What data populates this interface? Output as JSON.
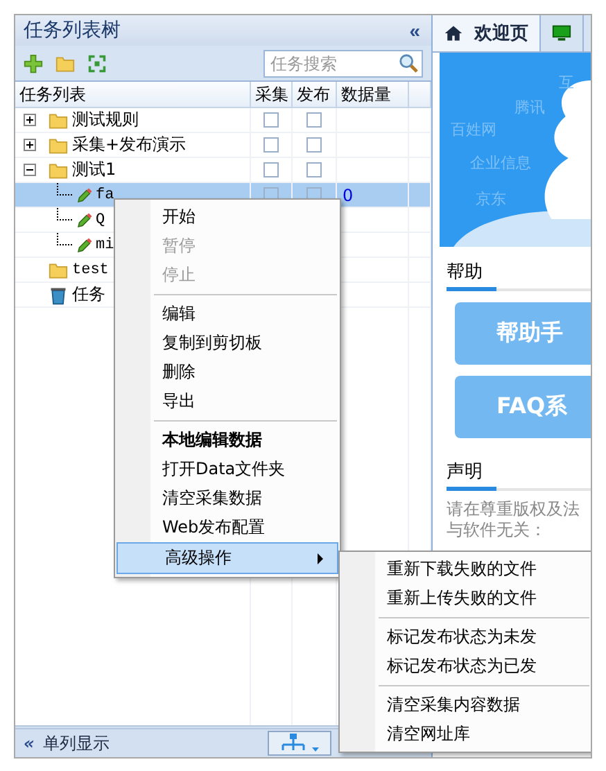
{
  "left_panel": {
    "title": "任务列表树",
    "collapse": "«",
    "search": {
      "placeholder": "任务搜索"
    },
    "columns": [
      "任务列表",
      "采集",
      "发布",
      "数据量"
    ],
    "tree": [
      {
        "label": "测试规则",
        "kind": "folder",
        "expanded": false,
        "selected": false,
        "collect": false,
        "publish": false
      },
      {
        "label": "采集+发布演示",
        "kind": "folder",
        "expanded": false,
        "selected": false,
        "collect": false,
        "publish": false
      },
      {
        "label": "测试1",
        "kind": "folder",
        "expanded": true,
        "selected": false,
        "collect": false,
        "publish": false,
        "children": [
          {
            "label": "fa",
            "kind": "task",
            "selected": true,
            "collect": false,
            "publish": false,
            "count": "0"
          },
          {
            "label": "Q",
            "kind": "task",
            "selected": false
          },
          {
            "label": "mi",
            "kind": "task",
            "selected": false
          }
        ]
      },
      {
        "label": "test",
        "kind": "folder",
        "selected": false
      },
      {
        "label": "任务",
        "kind": "recycle",
        "selected": false
      }
    ],
    "footer": {
      "collapse": "«",
      "label": "单列显示"
    }
  },
  "right_panel": {
    "tabs": [
      {
        "label": "欢迎页",
        "kind": "home",
        "selected": true
      },
      {
        "kind": "monitor",
        "selected": false
      }
    ],
    "banner_words": [
      "互",
      "腾讯",
      "百姓网",
      "企业信息",
      "京东"
    ],
    "help": {
      "title": "帮助",
      "buttons": [
        "帮助手",
        "FAQ系"
      ]
    },
    "notice": {
      "title": "声明",
      "lines": [
        "请在尊重版权及法",
        "与软件无关："
      ]
    }
  },
  "context_menu": [
    {
      "kind": "item",
      "label": "开始",
      "disabled": false
    },
    {
      "kind": "item",
      "label": "暂停",
      "disabled": true
    },
    {
      "kind": "item",
      "label": "停止",
      "disabled": true
    },
    {
      "kind": "separator"
    },
    {
      "kind": "item",
      "label": "编辑",
      "disabled": false
    },
    {
      "kind": "item",
      "label": "复制到剪切板",
      "disabled": false
    },
    {
      "kind": "item",
      "label": "删除",
      "disabled": false
    },
    {
      "kind": "item",
      "label": "导出",
      "disabled": false
    },
    {
      "kind": "separator"
    },
    {
      "kind": "heading",
      "label": "本地编辑数据"
    },
    {
      "kind": "item",
      "label": "打开Data文件夹",
      "disabled": false
    },
    {
      "kind": "item",
      "label": "清空采集数据",
      "disabled": false
    },
    {
      "kind": "item",
      "label": "Web发布配置",
      "disabled": false
    },
    {
      "kind": "submenu",
      "label": "高级操作",
      "selected": true,
      "items": [
        {
          "kind": "item",
          "label": "重新下载失败的文件"
        },
        {
          "kind": "item",
          "label": "重新上传失败的文件"
        },
        {
          "kind": "separator"
        },
        {
          "kind": "item",
          "label": "标记发布状态为未发"
        },
        {
          "kind": "item",
          "label": "标记发布状态为已发"
        },
        {
          "kind": "separator"
        },
        {
          "kind": "item",
          "label": "清空采集内容数据"
        },
        {
          "kind": "item",
          "label": "清空网址库"
        }
      ]
    }
  ]
}
